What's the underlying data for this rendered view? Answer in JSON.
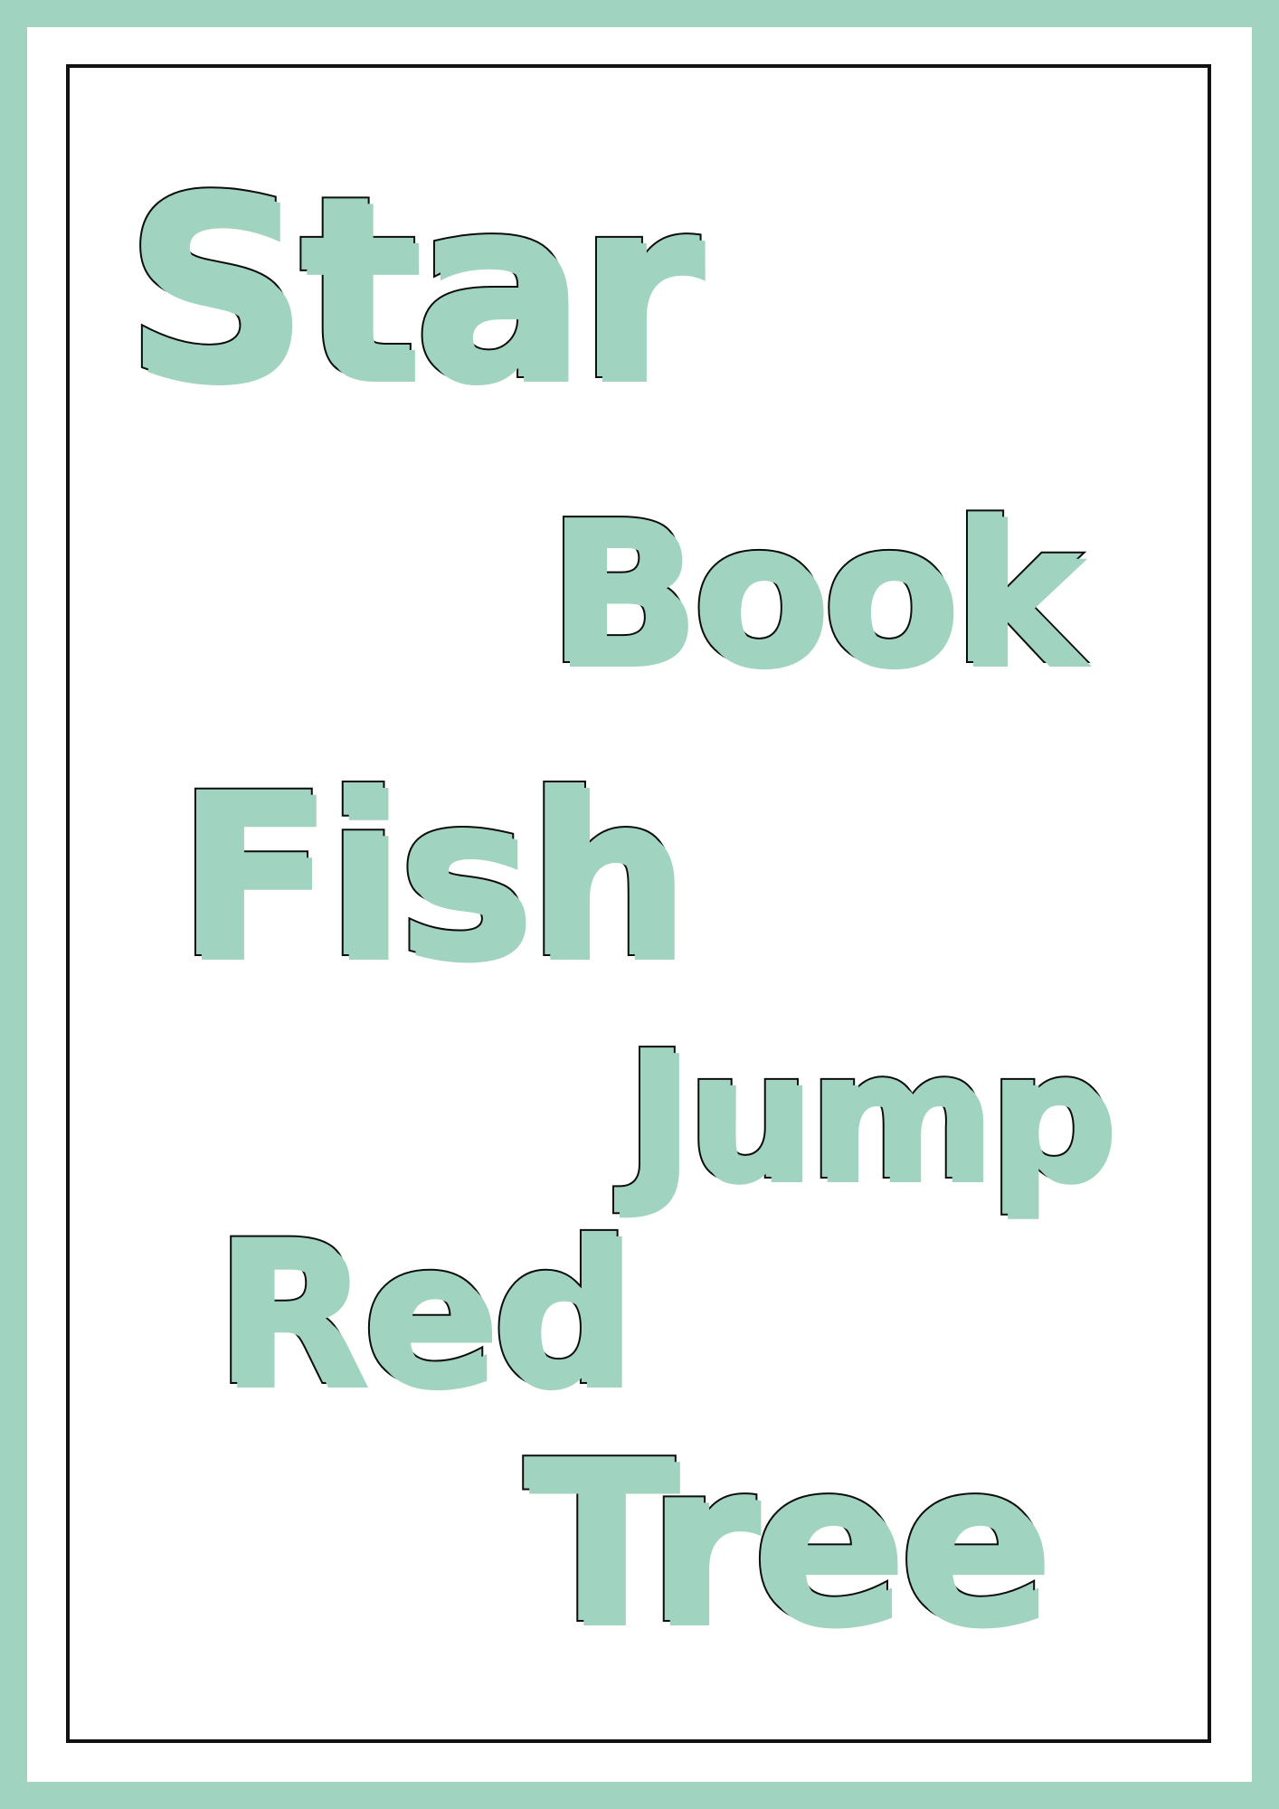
{
  "theme": {
    "fill_color": "#a0d4c1",
    "outline_color": "#0d0d0d",
    "frame_color": "#111111",
    "background": "#ffffff"
  },
  "words": {
    "star": "Star",
    "book": "Book",
    "fish": "Fish",
    "jump": "Jump",
    "red": "Red",
    "tree": "Tree"
  }
}
